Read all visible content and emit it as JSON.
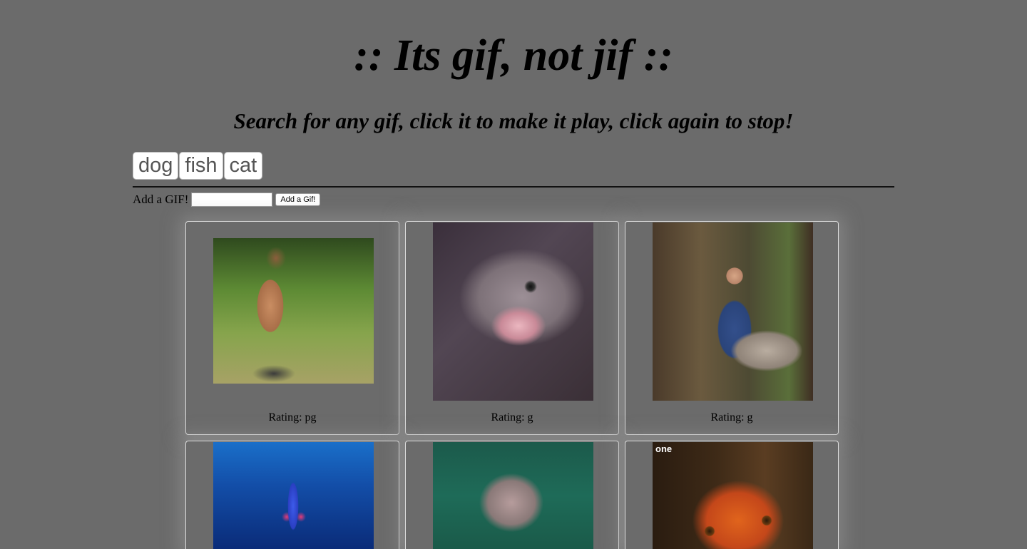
{
  "header": {
    "title": ":: Its gif, not jif ::",
    "subtitle": "Search for any gif, click it to make it play, click again to stop!"
  },
  "topics": [
    "dog",
    "fish",
    "cat"
  ],
  "add_form": {
    "label": "Add a GIF!",
    "input_value": "",
    "button_label": "Add a Gif!"
  },
  "gifs": [
    {
      "rating": "Rating: pg",
      "depicts": "man-running-in-grass"
    },
    {
      "rating": "Rating: g",
      "depicts": "fish-open-mouth"
    },
    {
      "rating": "Rating: g",
      "depicts": "chef-with-big-fish"
    },
    {
      "rating": "",
      "depicts": "blue-fish-underwater"
    },
    {
      "rating": "",
      "depicts": "puffer-fish"
    },
    {
      "rating": "",
      "depicts": "goldfish",
      "logo_text": "one"
    }
  ]
}
